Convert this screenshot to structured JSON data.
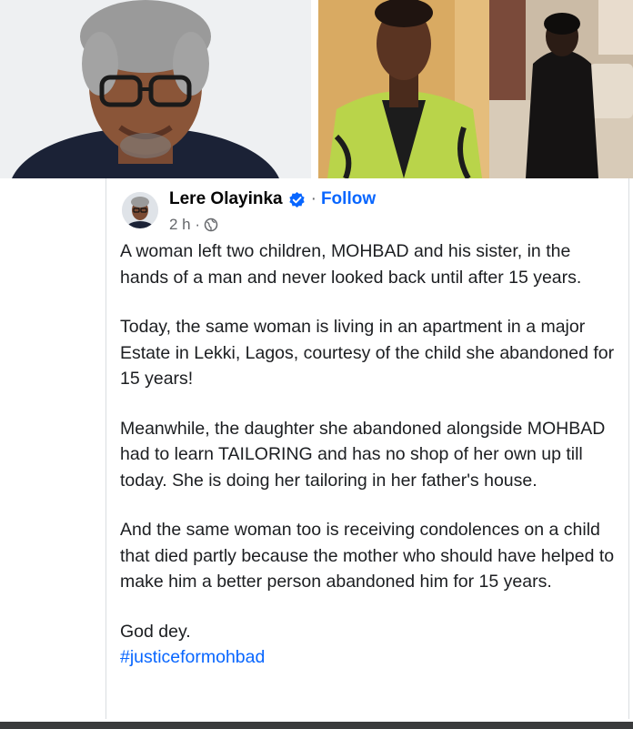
{
  "post": {
    "author": "Lere Olayinka",
    "follow_label": "Follow",
    "separator": "·",
    "time": "2 h ·",
    "paragraphs": [
      "A woman left two children, MOHBAD and his sister, in the hands of a man and never looked back until after 15 years.",
      "Today, the same woman is living in an apartment in a major Estate in Lekki, Lagos, courtesy of the child she abandoned for 15 years!",
      "Meanwhile, the daughter she abandoned alongside MOHBAD had to learn TAILORING and has no shop of her own up till today. She is doing her tailoring in her father's house.",
      "And the same woman too is receiving condolences on a child that died partly because the mother who should have helped to make him a better person abandoned him for 15 years.",
      "God dey."
    ],
    "hashtag": "#justiceformohbad"
  },
  "colors": {
    "link": "#0866ff",
    "text": "#1c1e21",
    "muted": "#65676b"
  },
  "icons": [
    "verified-badge-icon",
    "globe-icon"
  ]
}
